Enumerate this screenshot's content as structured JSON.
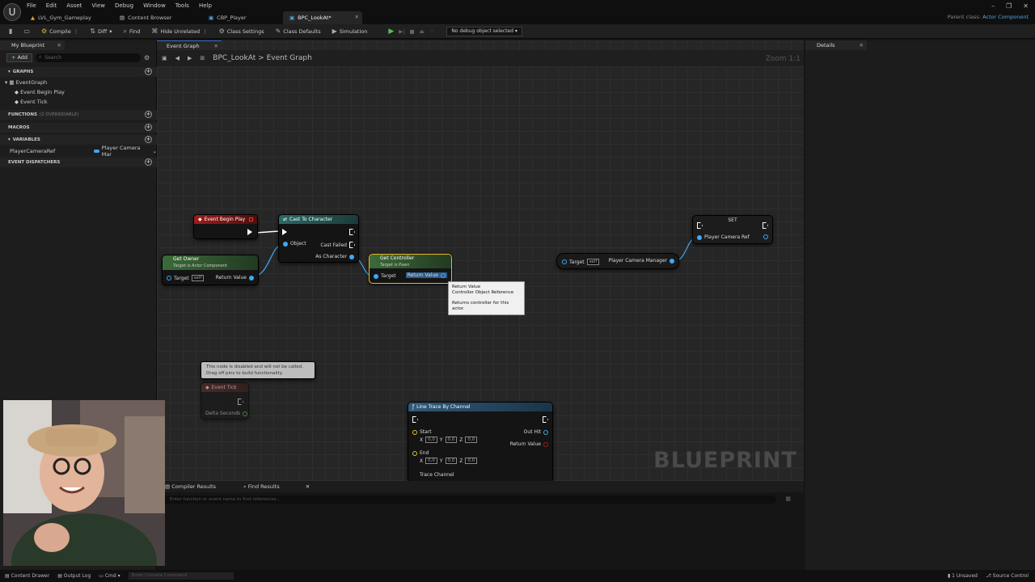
{
  "menu": [
    "File",
    "Edit",
    "Asset",
    "View",
    "Debug",
    "Window",
    "Tools",
    "Help"
  ],
  "tabs": [
    {
      "label": "LVL_Gym_Gameplay",
      "active": false
    },
    {
      "label": "Content Browser",
      "active": false
    },
    {
      "label": "CBP_Player",
      "active": false
    },
    {
      "label": "BPC_LookAt*",
      "active": true
    }
  ],
  "parent_class": {
    "prefix": "Parent class:",
    "value": "Actor Component"
  },
  "toolbar": {
    "save_icon": "save-icon",
    "compile": "Compile",
    "diff": "Diff",
    "find": "Find",
    "hide_unrelated": "Hide Unrelated",
    "class_settings": "Class Settings",
    "class_defaults": "Class Defaults",
    "simulation": "Simulation",
    "debug_select": "No debug object selected"
  },
  "left": {
    "tab": "My Blueprint",
    "add": "Add",
    "search_placeholder": "Search",
    "graphs_header": "GRAPHS",
    "graph_items": [
      "EventGraph",
      "Event Begin Play",
      "Event Tick"
    ],
    "functions_header": "FUNCTIONS",
    "functions_sub": "(2 OVERRIDABLE)",
    "macros_header": "MACROS",
    "variables_header": "VARIABLES",
    "variable_name": "PlayerCameraRef",
    "variable_type": "Player Camera Mar",
    "dispatchers_header": "EVENT DISPATCHERS"
  },
  "graph": {
    "tab": "Event Graph",
    "crumb_bp": "BPC_LookAt",
    "crumb_sep": ">",
    "crumb_graph": "Event Graph",
    "zoom": "Zoom 1:1",
    "watermark": "BLUEPRINT"
  },
  "nodes": {
    "begin_play": "Event Begin Play",
    "cast_title": "Cast To Character",
    "cast_object": "Object",
    "cast_failed": "Cast Failed",
    "cast_as": "As Character",
    "get_owner": "Get Owner",
    "get_owner_sub": "Target is Actor Component",
    "target": "Target",
    "self": "self",
    "return_value": "Return Value",
    "get_controller": "Get Controller",
    "get_controller_sub": "Target is Pawn",
    "pcm_label": "Player Camera Manager",
    "set_title": "SET",
    "set_var": "Player Camera Ref",
    "disabled_note_1": "This node is disabled and will not be called.",
    "disabled_note_2": "Drag off pins to build functionality.",
    "event_tick": "Event Tick",
    "delta": "Delta Seconds",
    "line_trace": "Line Trace By Channel",
    "start": "Start",
    "end": "End",
    "out_hit": "Out Hit",
    "trace_channel": "Trace Channel",
    "vec_x": "X",
    "vec_y": "Y",
    "vec_z": "Z",
    "vec_val": "0,0"
  },
  "tooltip": {
    "line1": "Return Value",
    "line2": "Controller Object Reference",
    "line3": "Returns controller for this actor."
  },
  "bottom": {
    "tab1": "Compiler Results",
    "tab2": "Find Results",
    "find_placeholder": "Enter function or event name to find references..."
  },
  "details": {
    "tab": "Details"
  },
  "status": {
    "content_drawer": "Content Drawer",
    "output_log": "Output Log",
    "cmd": "Cmd",
    "console_placeholder": "Enter Console Command",
    "unsaved": "1 Unsaved",
    "source_control": "Source Control"
  },
  "colors": {
    "event_red": "#a11b1b",
    "cast_teal": "#2a6a66",
    "pure_green": "#3c6b3a",
    "func_blue": "#2f5a7a",
    "object_pin": "#3fa9f5",
    "select_yellow": "#e8b923"
  }
}
